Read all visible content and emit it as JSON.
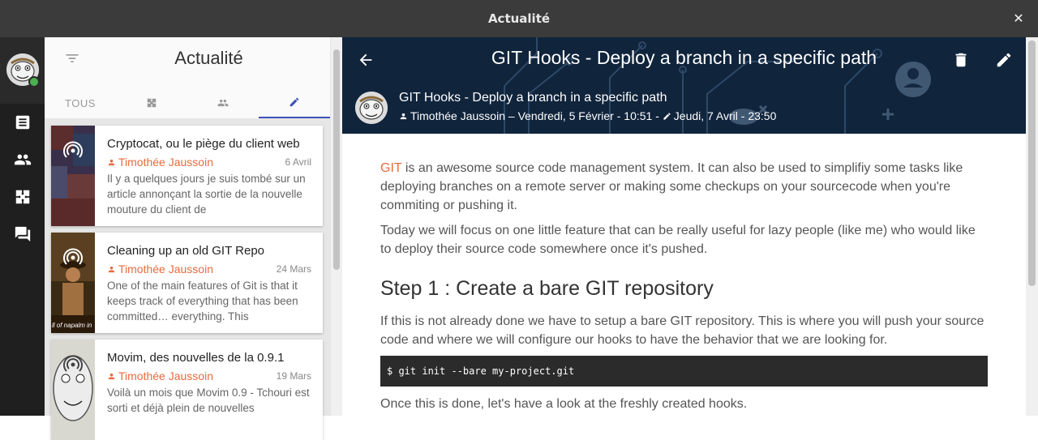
{
  "window": {
    "title": "Actualité",
    "close_glyph": "✕"
  },
  "leftnav": {
    "items": [
      {
        "icon": "news-icon"
      },
      {
        "icon": "contacts-icon"
      },
      {
        "icon": "communities-icon"
      },
      {
        "icon": "chat-icon"
      }
    ],
    "presence_color": "#4caf50"
  },
  "list": {
    "title": "Actualité",
    "tabs": [
      {
        "label": "TOUS"
      },
      {
        "icon": "communities-icon"
      },
      {
        "icon": "contacts-icon"
      },
      {
        "icon": "pencil-icon",
        "active": true
      }
    ],
    "cards": [
      {
        "title": "Cryptocat, ou le piège du client web",
        "author": "Timothée Jaussoin",
        "date": "6 Avril",
        "excerpt": "Il y a quelques jours je suis tombé sur un article annonçant la sortie de la nouvelle mouture du client de"
      },
      {
        "title": "Cleaning up an old GIT Repo",
        "author": "Timothée Jaussoin",
        "date": "24 Mars",
        "excerpt": "One of the main features of Git is that it keeps track of everything that has been committed… everything. This",
        "thumb_caption": "ll of napalm in"
      },
      {
        "title": "Movim, des nouvelles de la 0.9.1",
        "author": "Timothée Jaussoin",
        "date": "19 Mars",
        "excerpt": "Voilà un mois que Movim 0.9 - Tchouri est sorti et déjà plein de nouvelles"
      }
    ]
  },
  "article": {
    "title": "GIT Hooks - Deploy a branch in a specific path",
    "subtitle": "GIT Hooks - Deploy a branch in a specific path",
    "author": "Timothée Jaussoin",
    "published": "Vendredi, 5 Février - 10:51",
    "edited": "Jeudi, 7 Avril - 23:50",
    "meta_sep1": "–",
    "meta_sep2": "-",
    "p1_link": "GIT",
    "p1_rest": " is an awesome source code management system. It can also be used to simplifiy some tasks like deploying branches on a remote server or making some checkups on your sourcecode when you're commiting or pushing it.",
    "p2": "Today we will focus on one little feature that can be really useful for lazy people (like me) who would like to deploy their source code somewhere once it's pushed.",
    "h2": "Step 1 : Create a bare GIT repository",
    "p3": "If this is not already done we have to setup a bare GIT repository. This is where you will push your source code and where we will configure our hooks to have the behavior that we are looking for.",
    "code": "$ git init --bare my-project.git",
    "p4": "Once this is done, let's have a look at the freshly created hooks."
  },
  "colors": {
    "accent": "#e86b3f",
    "tab_active": "#3f51b5",
    "banner": "#10243c"
  }
}
